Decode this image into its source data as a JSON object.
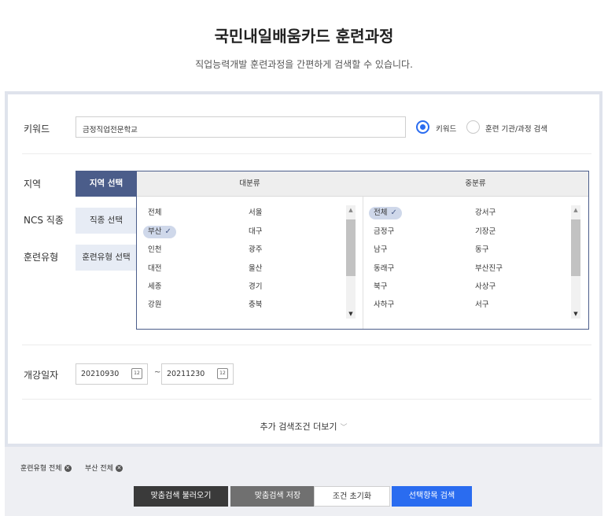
{
  "header": {
    "title": "국민내일배움카드 훈련과정",
    "subtitle": "직업능력개발 훈련과정을 간편하게 검색할 수 있습니다."
  },
  "form": {
    "keyword_label": "키워드",
    "keyword_value": "금정직업전문학교",
    "radio_keyword": "키워드",
    "radio_institution": "훈련 기관/과정 검색",
    "region_label": "지역",
    "ncs_label": "NCS 직종",
    "training_type_label": "훈련유형",
    "tab_region": "지역 선택",
    "tab_ncs": "직종 선택",
    "tab_training_type": "훈련유형 선택",
    "date_label": "개강일자",
    "date_from": "20210930",
    "date_to": "20211230",
    "date_sep": "~",
    "more_label": "추가 검색조건 더보기"
  },
  "dropdown": {
    "major_header": "대분류",
    "minor_header": "중분류",
    "major_items": [
      "전체",
      "서울",
      "부산",
      "대구",
      "인천",
      "광주",
      "대전",
      "울산",
      "세종",
      "경기",
      "강원",
      "충북"
    ],
    "major_selected": "부산",
    "minor_items": [
      "전체",
      "강서구",
      "금정구",
      "기장군",
      "남구",
      "동구",
      "동래구",
      "부산진구",
      "북구",
      "사상구",
      "사하구",
      "서구"
    ],
    "minor_selected": "전체"
  },
  "chips": [
    "훈련유형 전체",
    "부산 전체"
  ],
  "buttons": {
    "load_custom": "맞춤검색 불러오기",
    "save_custom": "맞춤검색 저장",
    "reset": "조건 초기화",
    "search": "선택항목 검색"
  },
  "colors": {
    "accent": "#2a6cf0",
    "tab_active": "#4b5d8a",
    "panel_border": "#dfe3ec"
  }
}
